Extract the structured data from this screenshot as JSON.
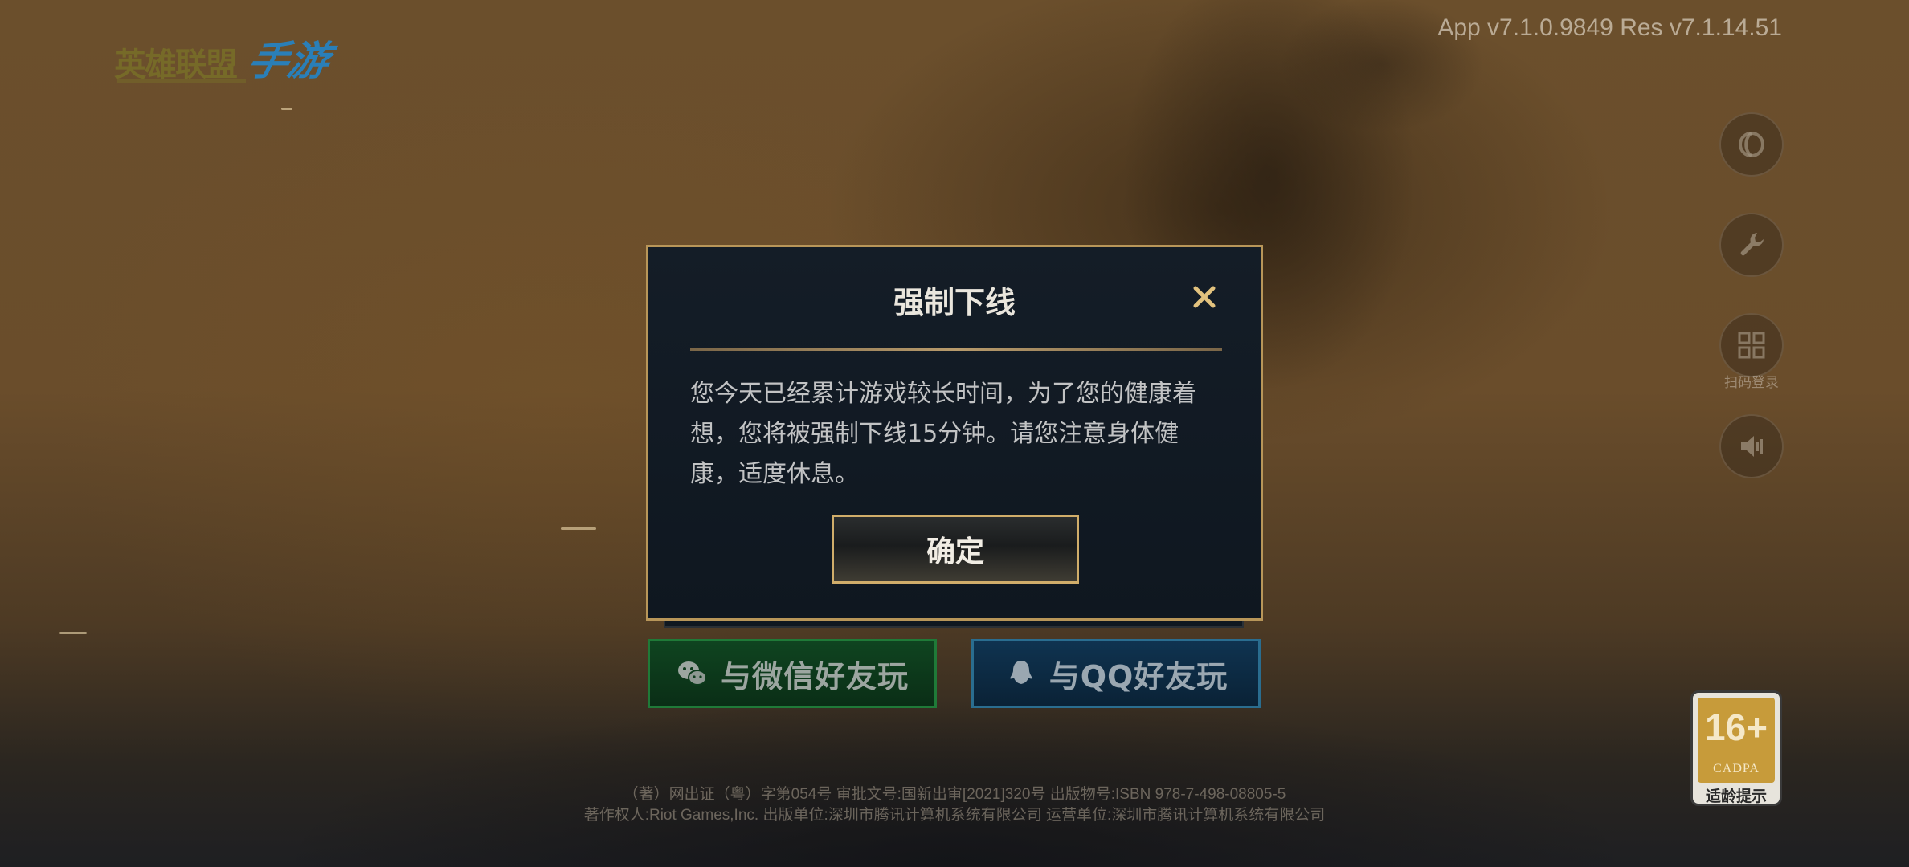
{
  "header": {
    "logo_text": "英雄联盟",
    "logo_script": "手游",
    "version": "App v7.1.0.9849 Res v7.1.14.51"
  },
  "side_buttons": {
    "qr_login_caption": "扫码登录",
    "icons": [
      "scout-icon",
      "wrench-icon",
      "qr-code-icon",
      "volume-icon"
    ]
  },
  "dialog": {
    "title": "强制下线",
    "message": "您今天已经累计游戏较长时间，为了您的健康着想，您将被强制下线15分钟。请您注意身体健康，适度休息。",
    "confirm_label": "确定",
    "close_icon": "close-icon"
  },
  "login": {
    "wechat_label": "与微信好友玩",
    "qq_label": "与QQ好友玩"
  },
  "age_rating": {
    "rating": "16+",
    "org": "CADPA",
    "label": "适龄提示"
  },
  "footer": {
    "line1": "（著）网出证（粤）字第054号  审批文号:国新出审[2021]320号  出版物号:ISBN 978-7-498-08805-5",
    "line2": "著作权人:Riot Games,Inc.  出版单位:深圳市腾讯计算机系统有限公司  运营单位:深圳市腾讯计算机系统有限公司"
  },
  "colors": {
    "dialog_border": "#b89659",
    "dialog_bg": "#141d27",
    "wechat_green": "#1f7a38",
    "qq_blue": "#2a6d8f",
    "age_gold": "#c79b3a"
  }
}
